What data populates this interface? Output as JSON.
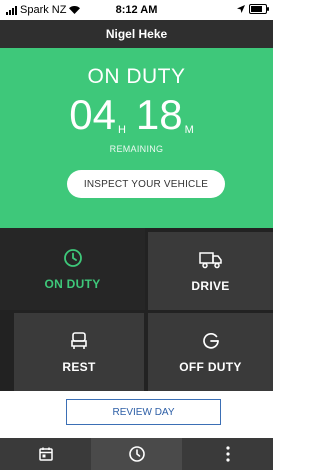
{
  "status_bar": {
    "carrier": "Spark NZ",
    "time": "8:12 AM"
  },
  "header": {
    "driver_name": "Nigel Heke"
  },
  "hero": {
    "status": "ON DUTY",
    "hours": "04",
    "hours_unit": "H",
    "minutes": "18",
    "minutes_unit": "M",
    "remaining_label": "REMAINING",
    "inspect_button": "INSPECT YOUR VEHICLE"
  },
  "duty_tiles": [
    {
      "label": "ON DUTY",
      "icon": "clock-icon",
      "selected": true
    },
    {
      "label": "DRIVE",
      "icon": "truck-icon",
      "selected": false
    },
    {
      "label": "REST",
      "icon": "rest-icon",
      "selected": false
    },
    {
      "label": "OFF DUTY",
      "icon": "power-icon",
      "selected": false
    }
  ],
  "review_button": "REVIEW DAY",
  "tabbar": {
    "tabs": [
      {
        "icon": "calendar-icon",
        "active": false
      },
      {
        "icon": "clock-icon",
        "active": true
      },
      {
        "icon": "more-icon",
        "active": false
      }
    ]
  },
  "colors": {
    "accent_green": "#3ec87a",
    "header_dark": "#2f2f2f",
    "tile_dark": "#3a3a3a",
    "link_blue": "#2c5ea6"
  }
}
